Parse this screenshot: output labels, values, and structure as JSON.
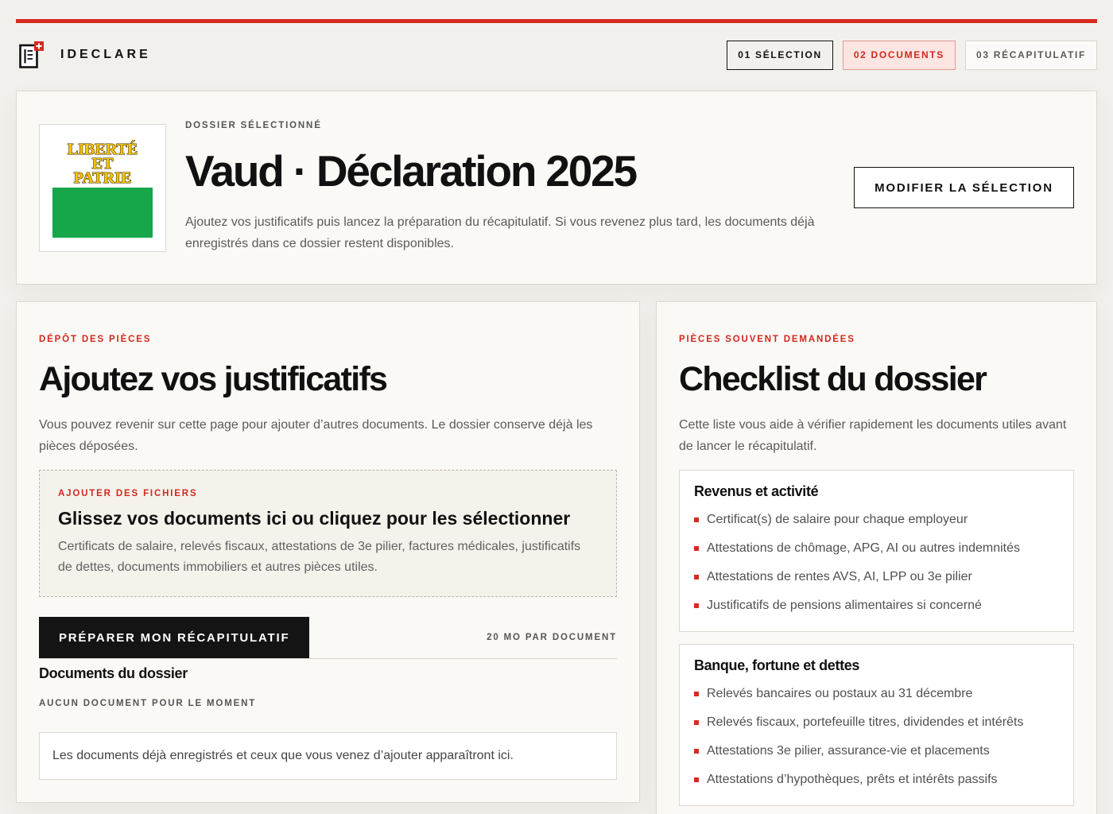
{
  "theme": {
    "accent": "#d52b1e",
    "ink": "#111111",
    "muted": "#5a5a5a",
    "page": "#f2f0ec",
    "card": "#faf9f6"
  },
  "app": {
    "name": "IDECLARE",
    "logo_icon": "document-swiss-cross-icon"
  },
  "steps": [
    {
      "label": "01 SÉLECTION"
    },
    {
      "label": "02 DOCUMENTS"
    },
    {
      "label": "03 RÉCAPITULATIF"
    }
  ],
  "dossier": {
    "eyebrow": "DOSSIER SÉLECTIONNÉ",
    "title": "Vaud · Déclaration 2025",
    "description": "Ajoutez vos justificatifs puis lancez la préparation du récapitulatif. Si vous revenez plus tard, les documents déjà enregistrés dans ce dossier restent disponibles.",
    "modify_button": "MODIFIER LA SÉLECTION",
    "flag": {
      "motto": [
        "LIBERTÉ",
        "ET",
        "PATRIE"
      ],
      "colors": {
        "top": "#ffffff",
        "bottom": "#17a74a",
        "motto": "#f7c400"
      }
    }
  },
  "upload": {
    "eyebrow": "DÉPÔT DES PIÈCES",
    "title": "Ajoutez vos justificatifs",
    "description": "Vous pouvez revenir sur cette page pour ajouter d’autres documents. Le dossier conserve déjà les pièces déposées.",
    "dropzone": {
      "eyebrow": "AJOUTER DES FICHIERS",
      "title": "Glissez vos documents ici ou cliquez pour les sélectionner",
      "description": "Certificats de salaire, relevés fiscaux, attestations de 3e pilier, factures médicales, justificatifs de dettes, documents immobiliers et autres pièces utiles."
    },
    "prepare_button": "PRÉPARER MON RÉCAPITULATIF",
    "size_limit": "20 MO PAR DOCUMENT",
    "documents": {
      "title": "Documents du dossier",
      "status": "AUCUN DOCUMENT POUR LE MOMENT",
      "empty_message": "Les documents déjà enregistrés et ceux que vous venez d’ajouter apparaîtront ici."
    }
  },
  "checklist": {
    "eyebrow": "PIÈCES SOUVENT DEMANDÉES",
    "title": "Checklist du dossier",
    "description": "Cette liste vous aide à vérifier rapidement les documents utiles avant de lancer le récapitulatif.",
    "bullet_icon": "red-square-bullet",
    "groups": [
      {
        "title": "Revenus et activité",
        "items": [
          "Certificat(s) de salaire pour chaque employeur",
          "Attestations de chômage, APG, AI ou autres indemnités",
          "Attestations de rentes AVS, AI, LPP ou 3e pilier",
          "Justificatifs de pensions alimentaires si concerné"
        ]
      },
      {
        "title": "Banque, fortune et dettes",
        "items": [
          "Relevés bancaires ou postaux au 31 décembre",
          "Relevés fiscaux, portefeuille titres, dividendes et intérêts",
          "Attestations 3e pilier, assurance-vie et placements",
          "Attestations d’hypothèques, prêts et intérêts passifs"
        ]
      }
    ]
  }
}
